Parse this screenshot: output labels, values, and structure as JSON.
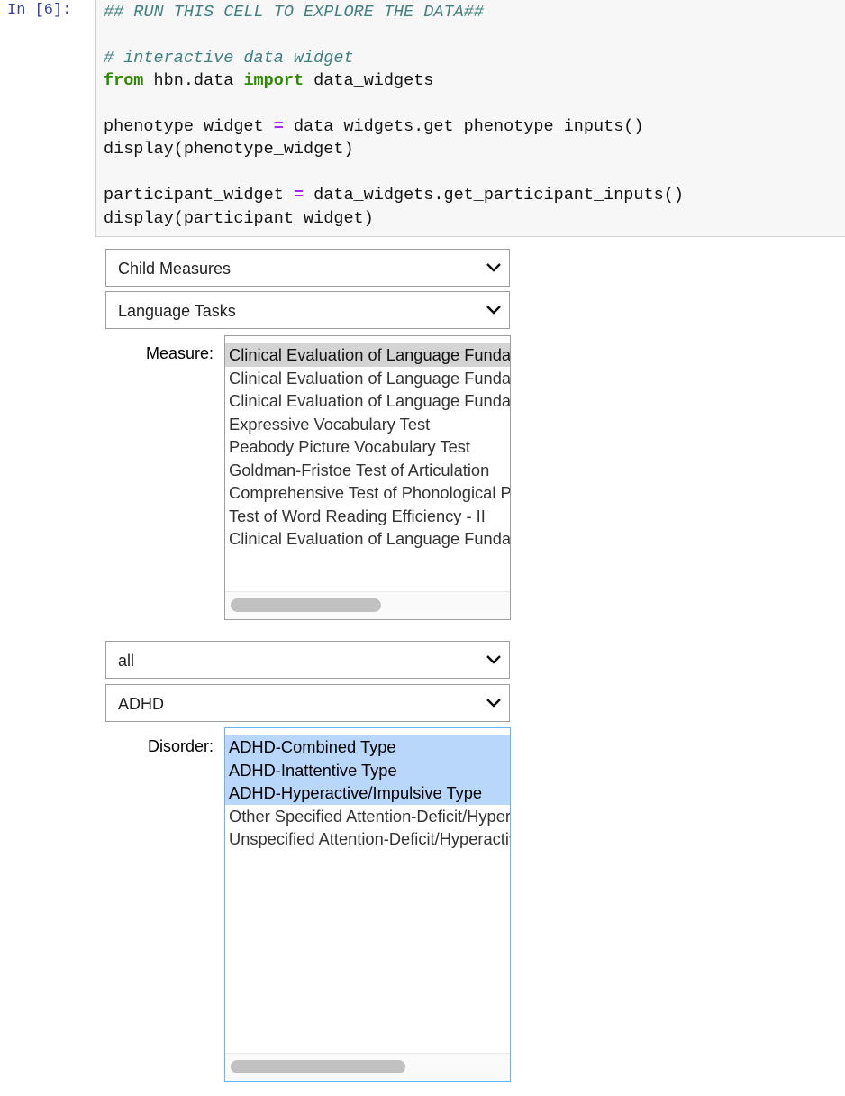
{
  "cell": {
    "prompt": "In [6]:",
    "lines": {
      "l1": "## RUN THIS CELL TO EXPLORE THE DATA##",
      "l2": "# interactive data widget",
      "l3_kw1": "from",
      "l3_mod": " hbn.data ",
      "l3_kw2": "import",
      "l3_rest": " data_widgets",
      "l4_a": "phenotype_widget ",
      "l4_op": "=",
      "l4_b": " data_widgets.get_phenotype_inputs()",
      "l5": "display(phenotype_widget)",
      "l6_a": "participant_widget ",
      "l6_op": "=",
      "l6_b": " data_widgets.get_participant_inputs()",
      "l7": "display(participant_widget)"
    }
  },
  "phenotype": {
    "category_select": "Child Measures",
    "subcategory_select": "Language Tasks",
    "measure_label": "Measure:",
    "measures": [
      "Clinical Evaluation of Language Fundamentals",
      "Clinical Evaluation of Language Fundamentals",
      "Clinical Evaluation of Language Fundamentals",
      "Expressive Vocabulary Test",
      "Peabody Picture Vocabulary Test",
      "Goldman-Fristoe Test of Articulation",
      "Comprehensive Test of Phonological Processing",
      "Test of Word Reading Efficiency - II",
      "Clinical Evaluation of Language Fundamentals"
    ],
    "selected_index": 0,
    "scroll_fraction": 0.0
  },
  "participant": {
    "filter_select": "all",
    "diagnosis_select": "ADHD",
    "disorder_label": "Disorder:",
    "disorders": [
      "ADHD-Combined Type",
      "ADHD-Inattentive Type",
      "ADHD-Hyperactive/Impulsive Type",
      "Other Specified Attention-Deficit/Hyperactivity Disorder",
      "Unspecified Attention-Deficit/Hyperactivity Disorder"
    ],
    "selected_indices": [
      0,
      1,
      2
    ]
  },
  "colors": {
    "selected_gray": "#d4d4d4",
    "selected_blue": "#b9d7fb",
    "focus_border": "#64b5f6",
    "prompt": "#303f9f"
  }
}
